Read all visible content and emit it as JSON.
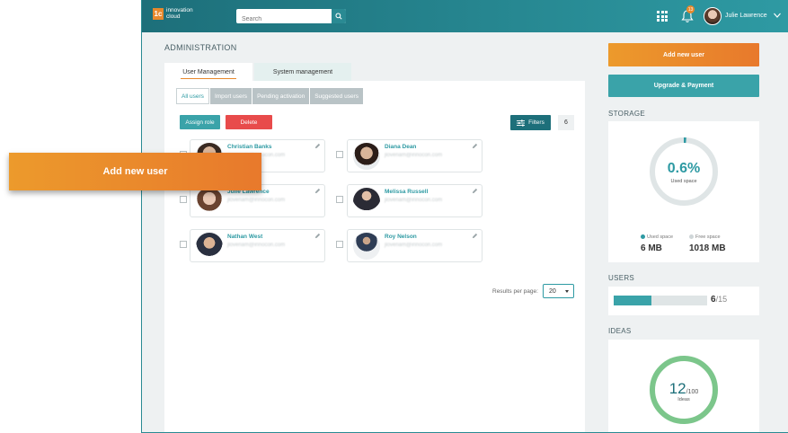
{
  "header": {
    "logo_mark": "1c",
    "logo_line1": "innovation",
    "logo_line2": "cloud",
    "search_placeholder": "Search",
    "notification_count": "13",
    "username": "Julie Lawrence"
  },
  "page_title": "ADMINISTRATION",
  "tabs": [
    {
      "label": "User Management",
      "active": true
    },
    {
      "label": "System management",
      "active": false
    }
  ],
  "subtabs": [
    {
      "label": "All users",
      "active": true
    },
    {
      "label": "Import users",
      "active": false
    },
    {
      "label": "Pending activation",
      "active": false
    },
    {
      "label": "Suggested users",
      "active": false
    }
  ],
  "actions": {
    "assign_role": "Assign role",
    "delete": "Delete",
    "filters": "Filters",
    "count": "6"
  },
  "users": [
    {
      "name": "Christian Banks",
      "email": "jlovenam@innocon.com"
    },
    {
      "name": "Diana Dean",
      "email": "jlovenam@innocon.com"
    },
    {
      "name": "Julie Lawrence",
      "email": "jlovenam@innocon.com"
    },
    {
      "name": "Melissa Russell",
      "email": "jlovenam@innocon.com"
    },
    {
      "name": "Nathan West",
      "email": "jlovenam@innocon.com"
    },
    {
      "name": "Roy Nelson",
      "email": "jlovenam@innocon.com"
    }
  ],
  "pagination": {
    "results_label": "Results per page:",
    "results_value": "20"
  },
  "side": {
    "add_user": "Add new user",
    "upgrade": "Upgrade & Payment",
    "storage_label": "STORAGE",
    "storage_percent": "0.6%",
    "storage_caption": "Used space",
    "storage_fraction": 0.006,
    "used_label": "Used space",
    "used_value": "6 MB",
    "free_label": "Free space",
    "free_value": "1018 MB",
    "users_label": "USERS",
    "users_current": "6",
    "users_total": "/15",
    "users_fraction": 0.4,
    "ideas_label": "IDEAS",
    "ideas_current": "12",
    "ideas_total": "/100",
    "ideas_caption": "Ideas"
  },
  "callout": "Add new user",
  "colors": {
    "accent_orange": "#e8892c",
    "teal": "#2e9aa3",
    "dark_teal": "#1d6f7a",
    "danger": "#e84b4b",
    "ideas_green": "#7cc68b"
  }
}
